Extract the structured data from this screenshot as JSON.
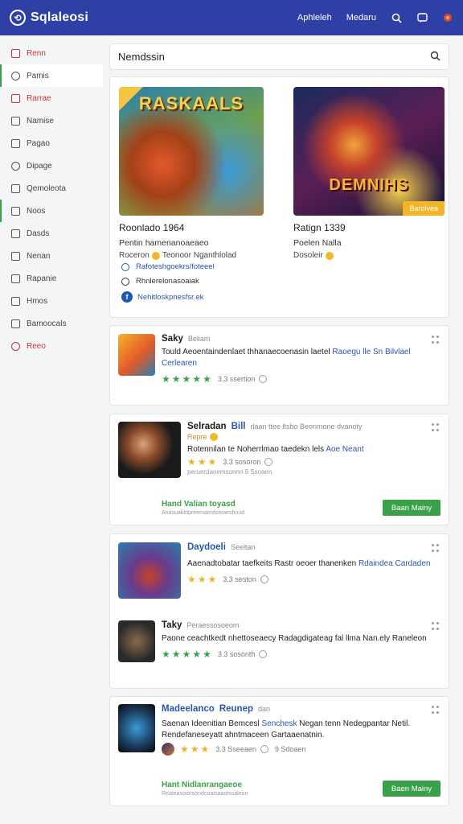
{
  "header": {
    "brand": "Sqlaleosi",
    "nav": [
      "Aphleleh",
      "Medaru"
    ],
    "icons": [
      "search-icon",
      "chat-icon",
      "notification-icon"
    ]
  },
  "sidebar": {
    "items": [
      {
        "label": "Renn",
        "icon": "home-icon"
      },
      {
        "label": "Pamis",
        "icon": "circle-icon"
      },
      {
        "label": "Rarrae",
        "icon": "shield-icon"
      },
      {
        "label": "Namise",
        "icon": "list-icon"
      },
      {
        "label": "Pagao",
        "icon": "house-icon"
      },
      {
        "label": "Dipage",
        "icon": "settings-icon"
      },
      {
        "label": "Qemoleota",
        "icon": "folder-icon"
      },
      {
        "label": "Noos",
        "icon": "lock-icon"
      },
      {
        "label": "Dasds",
        "icon": "warning-icon"
      },
      {
        "label": "Nenan",
        "icon": "grid-icon"
      },
      {
        "label": "Rapanie",
        "icon": "chat-icon"
      },
      {
        "label": "Hmos",
        "icon": "bookmark-icon"
      },
      {
        "label": "Bamoocals",
        "icon": "calendar-icon"
      },
      {
        "label": "Reeo",
        "icon": "help-icon"
      }
    ]
  },
  "search": {
    "value": "Nemdssin"
  },
  "featured": [
    {
      "banner_title": "RASKAALS",
      "title": "Roonlado 1964",
      "subtitle": "Pentin hamenanoaeaeo",
      "developer": "Roceron",
      "developer2": "Teonoor Nganthlolad"
    },
    {
      "banner_title": "DEMNIHS",
      "badge": "Barolvea",
      "title": "Ratign 1339",
      "subtitle": "Poelen Nalla",
      "developer": "Dosoleir"
    }
  ],
  "feature_meta": [
    {
      "text": "Rafoteshgoekrs/foteeel",
      "icon": "globe-icon"
    },
    {
      "text": "Rhnlerelonasoaiak",
      "icon": "info-icon"
    },
    {
      "text": "Nehitloskpnesfsr.ek",
      "icon": "facebook-icon"
    }
  ],
  "apps": [
    {
      "title": "Saky",
      "tag": "Beliam",
      "desc": "Tould Aeoentaindenlaet thhanaecoenasin laetel",
      "desc_hl": "Raoegu lle Sn Bilvlael Cerlearen",
      "rating_text": "3.3 ssertion"
    },
    {
      "title": "Selradan",
      "title_hl": "Bill",
      "tag": "rlaan ttee ltsbo Beonmone dvanoty",
      "dev": "Repre",
      "desc": "Rotennilan te Noherrlmao taedekn lels",
      "desc_hl": "Aoe Neant",
      "rating_text": "3.3 sosoron",
      "rating_sub": "peruerdaoemsonnn",
      "rating_extra": "9 Ssoaen",
      "link": "Hand Valian toyasd",
      "link_sub": "Anasuaktdpreemaerdsteaeshoud",
      "cta": "Baan Mainy"
    },
    {
      "title": "Daydoeli",
      "tag": "Seeltan",
      "desc": "Aaenadtobatar taefkeits Rastr oeoer thanenken",
      "desc_hl": "Rdaindea Cardaden",
      "rating_text": "3.3 seston"
    },
    {
      "title": "Taky",
      "tag": "Peraessosoeom",
      "desc": "Paone ceachtkedt nhettoseaecy Radagdigateag fal llma Nan.ely Raneleon",
      "rating_text": "3.3 sosonth"
    },
    {
      "title": "Madeelanco",
      "title_hl": "Reunep",
      "tag": "dan",
      "desc": "Saenan Ideenitian Bemcesl",
      "desc_hl": "Senchesk",
      "desc2": "Negan tenn Nedegpantar Netil. Rendefaneseyatt ahntmaceen Gartaaenatnin.",
      "rating_text": "3.3 Sseeaen",
      "rating_extra": "9 Sdoaen",
      "link": "Hant Nidlanrangaeoe",
      "link_sub": "Reateasoonsondcoatsaastsoaleon",
      "cta": "Baen Mainy"
    }
  ],
  "colors": {
    "header": "#2e3fa6",
    "accent_green": "#3aa14a",
    "link_blue": "#2b56a8",
    "star_yellow": "#e9b42a"
  }
}
